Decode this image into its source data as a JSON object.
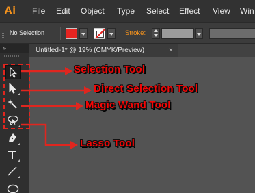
{
  "app": {
    "logo": "Ai"
  },
  "menu": {
    "items": [
      "File",
      "Edit",
      "Object",
      "Type",
      "Select",
      "Effect",
      "View",
      "Win"
    ]
  },
  "control_bar": {
    "selection_status": "No Selection",
    "stroke_label": "Stroke:",
    "fill_color": "#e52421",
    "stroke_color": "#e52421"
  },
  "document": {
    "tab_title": "Untitled-1* @ 19% (CMYK/Preview)",
    "close_glyph": "×"
  },
  "tools_panel": {
    "collapse_glyph": "»",
    "tools": [
      "selection-tool",
      "direct-selection-tool",
      "magic-wand-tool",
      "lasso-tool",
      "pen-tool",
      "type-tool",
      "line-segment-tool",
      "ellipse-tool"
    ]
  },
  "annotations": {
    "color": "#f40606",
    "labels": [
      "Selection Tool",
      "Direct Selection Tool",
      "Magic Wand Tool",
      "Lasso Tool"
    ]
  }
}
